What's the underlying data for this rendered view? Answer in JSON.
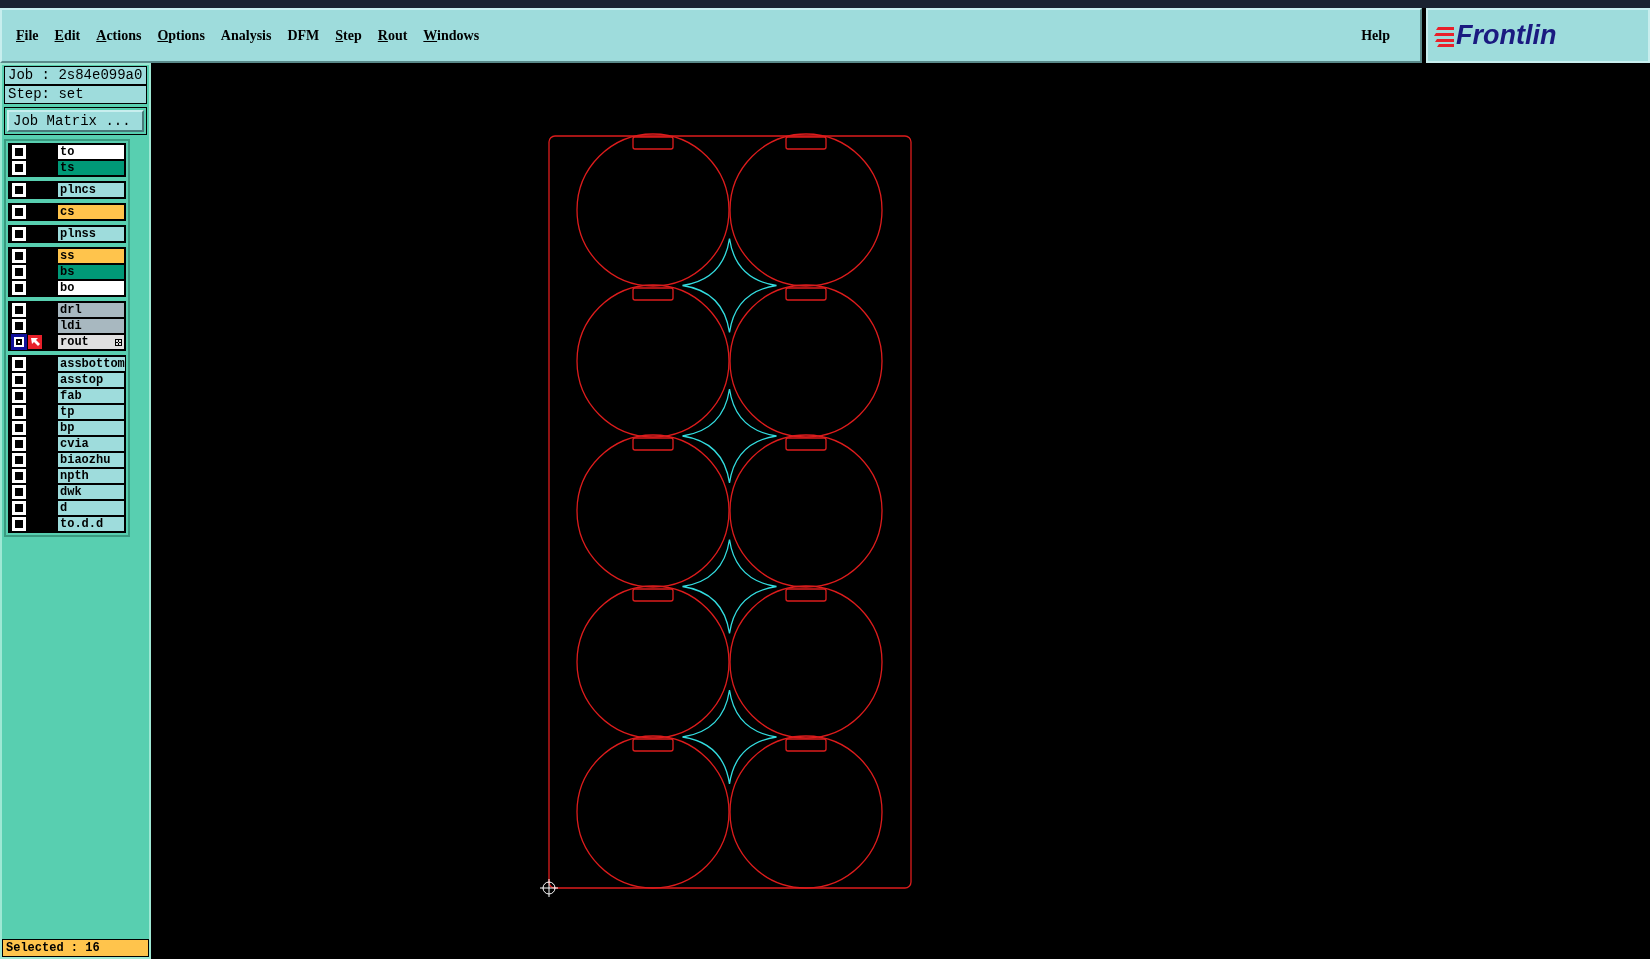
{
  "menu": [
    {
      "label": "File",
      "mnemonic": true
    },
    {
      "label": "Edit",
      "mnemonic": true
    },
    {
      "label": "Actions",
      "mnemonic": true
    },
    {
      "label": "Options",
      "mnemonic": true
    },
    {
      "label": "Analysis",
      "mnemonic": false
    },
    {
      "label": "DFM",
      "mnemonic": false
    },
    {
      "label": "Step",
      "mnemonic": true
    },
    {
      "label": "Rout",
      "mnemonic": true
    },
    {
      "label": "Windows",
      "mnemonic": true
    }
  ],
  "help": "Help",
  "logo": "Frontlin",
  "job": "Job : 2s84e099a0",
  "step": "Step: set",
  "job_matrix_button": "Job Matrix ...",
  "layer_groups": [
    [
      {
        "name": "to",
        "color": "#ffffff",
        "work": false
      },
      {
        "name": "ts",
        "color": "#009977",
        "work": false
      }
    ],
    [
      {
        "name": "plncs",
        "color": "#9edcdc",
        "work": false
      }
    ],
    [
      {
        "name": "cs",
        "color": "#ffc44c",
        "work": false
      }
    ],
    [
      {
        "name": "plnss",
        "color": "#9edcdc",
        "work": false
      }
    ],
    [
      {
        "name": "ss",
        "color": "#ffc44c",
        "work": false
      },
      {
        "name": "bs",
        "color": "#009977",
        "work": false
      },
      {
        "name": "bo",
        "color": "#ffffff",
        "work": false
      }
    ],
    [
      {
        "name": "drl",
        "color": "#a8b8c0",
        "work": false
      },
      {
        "name": "ldi",
        "color": "#a8b8c0",
        "work": false
      },
      {
        "name": "rout",
        "color": "#e0e0e0",
        "work": true
      }
    ],
    [
      {
        "name": "assbottom",
        "color": "#9edcdc",
        "work": false
      },
      {
        "name": "asstop",
        "color": "#9edcdc",
        "work": false
      },
      {
        "name": "fab",
        "color": "#9edcdc",
        "work": false
      },
      {
        "name": "tp",
        "color": "#9edcdc",
        "work": false
      },
      {
        "name": "bp",
        "color": "#9edcdc",
        "work": false
      },
      {
        "name": "cvia",
        "color": "#9edcdc",
        "work": false
      },
      {
        "name": "biaozhu",
        "color": "#9edcdc",
        "work": false
      },
      {
        "name": "npth",
        "color": "#9edcdc",
        "work": false
      },
      {
        "name": "dwk",
        "color": "#9edcdc",
        "work": false
      },
      {
        "name": "d",
        "color": "#9edcdc",
        "work": false
      },
      {
        "name": "to.d.d",
        "color": "#9edcdc",
        "work": false
      }
    ]
  ],
  "status": "Selected : 16"
}
